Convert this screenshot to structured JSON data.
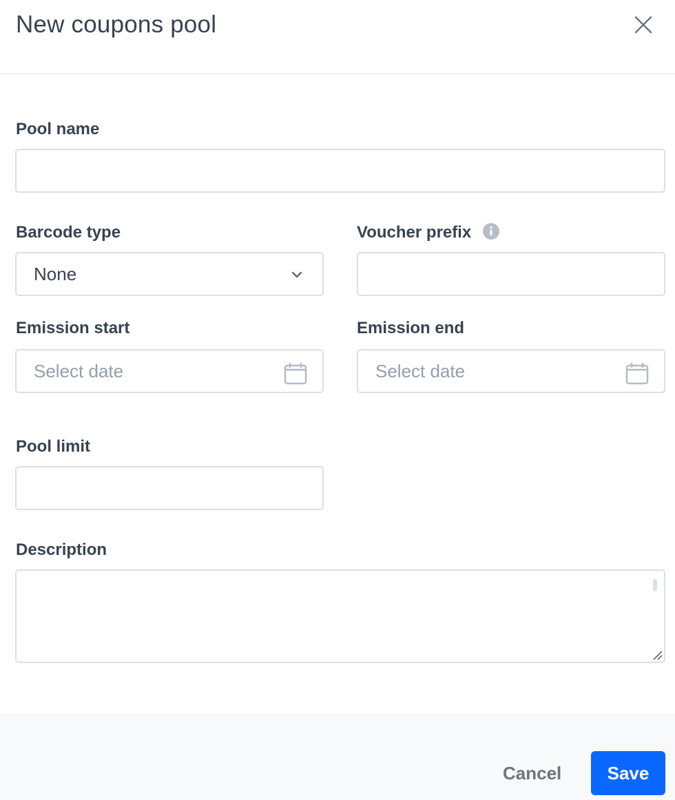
{
  "dialog": {
    "title": "New coupons pool",
    "close_icon": "close-icon"
  },
  "form": {
    "pool_name": {
      "label": "Pool name",
      "value": ""
    },
    "barcode_type": {
      "label": "Barcode type",
      "value": "None",
      "icon": "chevron-down-icon"
    },
    "voucher_prefix": {
      "label": "Voucher prefix",
      "value": "",
      "icon": "info-icon"
    },
    "emission_start": {
      "label": "Emission start",
      "placeholder": "Select date",
      "icon": "calendar-icon"
    },
    "emission_end": {
      "label": "Emission end",
      "placeholder": "Select date",
      "icon": "calendar-icon"
    },
    "pool_limit": {
      "label": "Pool limit",
      "value": ""
    },
    "description": {
      "label": "Description",
      "value": ""
    }
  },
  "footer": {
    "cancel_label": "Cancel",
    "save_label": "Save"
  },
  "colors": {
    "primary": "#0b68ff",
    "text": "#384350",
    "placeholder": "#949fa9",
    "border": "#dbe0e3",
    "footer_bg": "#f8f9fb"
  }
}
